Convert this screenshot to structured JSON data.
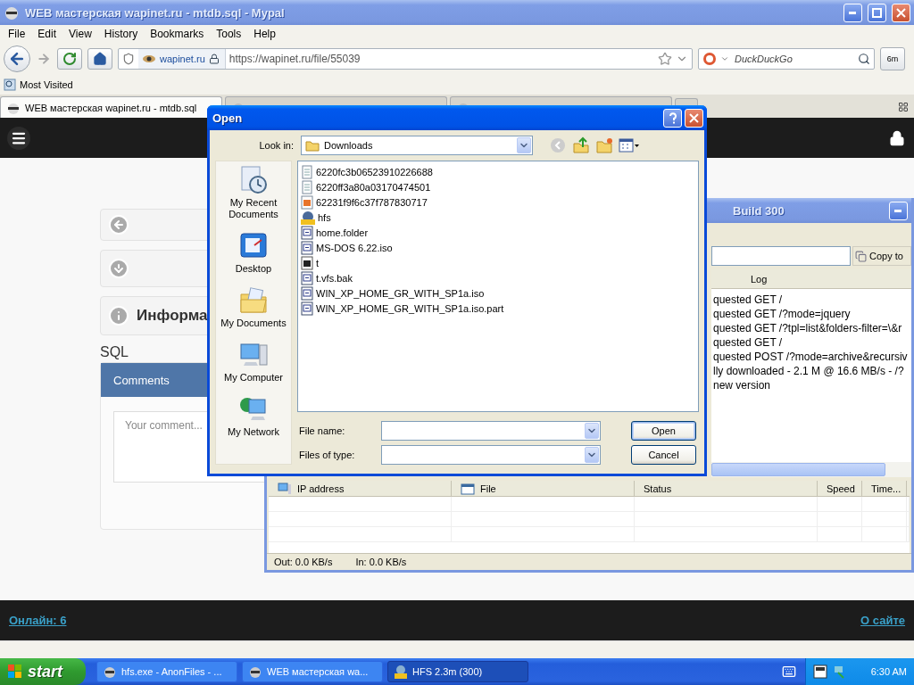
{
  "browser": {
    "title": "WEB мастерская wapinet.ru - mtdb.sql - Mypal",
    "menu": [
      "File",
      "Edit",
      "View",
      "History",
      "Bookmarks",
      "Tools",
      "Help"
    ],
    "site": "wapinet.ru",
    "url": "https://wapinet.ru/file/55039",
    "search_placeholder": "DuckDuckGo",
    "extra_button": "6m",
    "bookmarks": [
      "Most Visited"
    ],
    "tabs": [
      {
        "label": "WEB мастерская wapinet.ru - mtdb.sql",
        "selected": true
      },
      {
        "selected": false
      },
      {
        "selected": false
      }
    ]
  },
  "page": {
    "cards": [
      {
        "kind": "back"
      },
      {
        "kind": "download"
      },
      {
        "kind": "info",
        "label": "Информа"
      }
    ],
    "heading": "SQL",
    "comments": {
      "title": "Comments",
      "placeholder": "Your comment..."
    },
    "footer": {
      "online": "Онлайн: 6",
      "about": "О сайте"
    }
  },
  "hfs_window": {
    "title": "Build 300",
    "copy_button": "Copy to",
    "log_header": "Log",
    "log_lines": [
      "quested GET /",
      "quested GET /?mode=jquery",
      "quested GET /?tpl=list&folders-filter=\\&r",
      "quested GET /",
      "quested POST /?mode=archive&recursiv",
      "lly downloaded - 2.1 M @ 16.6 MB/s - /?",
      "new version"
    ],
    "columns": [
      {
        "label": "IP address",
        "kind": "ip"
      },
      {
        "label": "File",
        "kind": "file"
      },
      {
        "label": "Status",
        "kind": "plain"
      },
      {
        "label": "Speed",
        "kind": "plain"
      },
      {
        "label": "Time...",
        "kind": "plain"
      }
    ],
    "status": [
      "Out: 0.0 KB/s",
      "In: 0.0 KB/s"
    ]
  },
  "open_dialog": {
    "title": "Open",
    "look_in_label": "Look in:",
    "look_in": "Downloads",
    "places": [
      {
        "label": "My Recent Documents",
        "kind": "recent"
      },
      {
        "label": "Desktop",
        "kind": "desktop"
      },
      {
        "label": "My Documents",
        "kind": "documents"
      },
      {
        "label": "My Computer",
        "kind": "computer"
      },
      {
        "label": "My Network",
        "kind": "network"
      }
    ],
    "files": [
      {
        "name": "6220fc3b06523910226688",
        "kind": "text"
      },
      {
        "name": "6220ff3a80a03170474501",
        "kind": "text"
      },
      {
        "name": "62231f9f6c37f787830717",
        "kind": "image"
      },
      {
        "name": "hfs",
        "kind": "hfs"
      },
      {
        "name": "home.folder",
        "kind": "app"
      },
      {
        "name": "MS-DOS 6.22.iso",
        "kind": "app"
      },
      {
        "name": "t",
        "kind": "dark"
      },
      {
        "name": "t.vfs.bak",
        "kind": "app"
      },
      {
        "name": "WIN_XP_HOME_GR_WITH_SP1a.iso",
        "kind": "app"
      },
      {
        "name": "WIN_XP_HOME_GR_WITH_SP1a.iso.part",
        "kind": "app"
      }
    ],
    "file_name_label": "File name:",
    "file_type_label": "Files of type:",
    "buttons": [
      "Open",
      "Cancel"
    ]
  },
  "taskbar": {
    "start": "start",
    "tasks": [
      {
        "label": "hfs.exe - AnonFiles - ...",
        "kind": "browser",
        "selected": false
      },
      {
        "label": "WEB мастерская wa...",
        "kind": "browser",
        "selected": false
      },
      {
        "label": "HFS 2.3m (300)",
        "kind": "hfs",
        "selected": true
      }
    ],
    "clock": "6:30 AM"
  }
}
